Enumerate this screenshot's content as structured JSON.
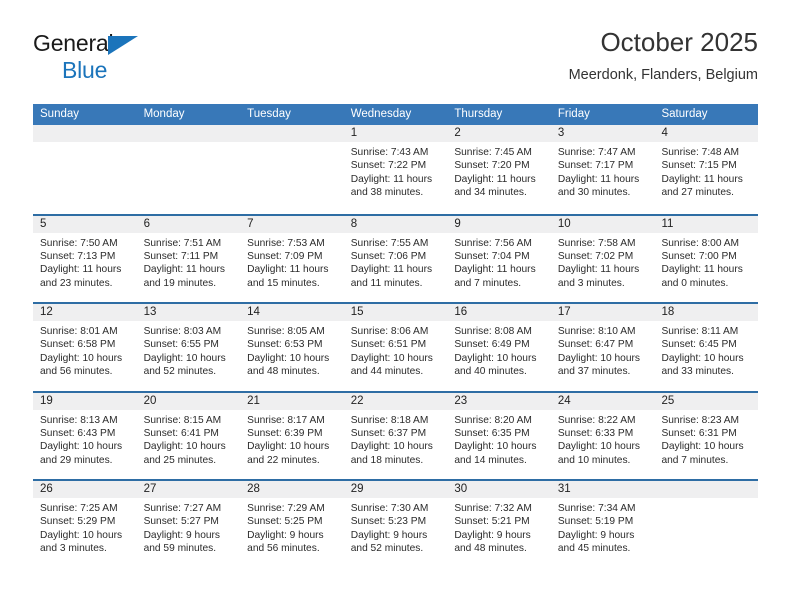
{
  "brand": {
    "line1": "General",
    "line2": "Blue",
    "accent_color": "#1b74bb",
    "text_color": "#1a1a1a"
  },
  "header": {
    "title": "October 2025",
    "subtitle": "Meerdonk, Flanders, Belgium"
  },
  "theme": {
    "header_bar_color": "#3878b8",
    "row_divider_color": "#2e6da4",
    "day_band_color": "#efeff0"
  },
  "weekdays": [
    "Sunday",
    "Monday",
    "Tuesday",
    "Wednesday",
    "Thursday",
    "Friday",
    "Saturday"
  ],
  "weeks": [
    [
      {
        "day": "",
        "sunrise": "",
        "sunset": "",
        "daylight_1": "",
        "daylight_2": ""
      },
      {
        "day": "",
        "sunrise": "",
        "sunset": "",
        "daylight_1": "",
        "daylight_2": ""
      },
      {
        "day": "",
        "sunrise": "",
        "sunset": "",
        "daylight_1": "",
        "daylight_2": ""
      },
      {
        "day": "1",
        "sunrise": "Sunrise: 7:43 AM",
        "sunset": "Sunset: 7:22 PM",
        "daylight_1": "Daylight: 11 hours",
        "daylight_2": "and 38 minutes."
      },
      {
        "day": "2",
        "sunrise": "Sunrise: 7:45 AM",
        "sunset": "Sunset: 7:20 PM",
        "daylight_1": "Daylight: 11 hours",
        "daylight_2": "and 34 minutes."
      },
      {
        "day": "3",
        "sunrise": "Sunrise: 7:47 AM",
        "sunset": "Sunset: 7:17 PM",
        "daylight_1": "Daylight: 11 hours",
        "daylight_2": "and 30 minutes."
      },
      {
        "day": "4",
        "sunrise": "Sunrise: 7:48 AM",
        "sunset": "Sunset: 7:15 PM",
        "daylight_1": "Daylight: 11 hours",
        "daylight_2": "and 27 minutes."
      }
    ],
    [
      {
        "day": "5",
        "sunrise": "Sunrise: 7:50 AM",
        "sunset": "Sunset: 7:13 PM",
        "daylight_1": "Daylight: 11 hours",
        "daylight_2": "and 23 minutes."
      },
      {
        "day": "6",
        "sunrise": "Sunrise: 7:51 AM",
        "sunset": "Sunset: 7:11 PM",
        "daylight_1": "Daylight: 11 hours",
        "daylight_2": "and 19 minutes."
      },
      {
        "day": "7",
        "sunrise": "Sunrise: 7:53 AM",
        "sunset": "Sunset: 7:09 PM",
        "daylight_1": "Daylight: 11 hours",
        "daylight_2": "and 15 minutes."
      },
      {
        "day": "8",
        "sunrise": "Sunrise: 7:55 AM",
        "sunset": "Sunset: 7:06 PM",
        "daylight_1": "Daylight: 11 hours",
        "daylight_2": "and 11 minutes."
      },
      {
        "day": "9",
        "sunrise": "Sunrise: 7:56 AM",
        "sunset": "Sunset: 7:04 PM",
        "daylight_1": "Daylight: 11 hours",
        "daylight_2": "and 7 minutes."
      },
      {
        "day": "10",
        "sunrise": "Sunrise: 7:58 AM",
        "sunset": "Sunset: 7:02 PM",
        "daylight_1": "Daylight: 11 hours",
        "daylight_2": "and 3 minutes."
      },
      {
        "day": "11",
        "sunrise": "Sunrise: 8:00 AM",
        "sunset": "Sunset: 7:00 PM",
        "daylight_1": "Daylight: 11 hours",
        "daylight_2": "and 0 minutes."
      }
    ],
    [
      {
        "day": "12",
        "sunrise": "Sunrise: 8:01 AM",
        "sunset": "Sunset: 6:58 PM",
        "daylight_1": "Daylight: 10 hours",
        "daylight_2": "and 56 minutes."
      },
      {
        "day": "13",
        "sunrise": "Sunrise: 8:03 AM",
        "sunset": "Sunset: 6:55 PM",
        "daylight_1": "Daylight: 10 hours",
        "daylight_2": "and 52 minutes."
      },
      {
        "day": "14",
        "sunrise": "Sunrise: 8:05 AM",
        "sunset": "Sunset: 6:53 PM",
        "daylight_1": "Daylight: 10 hours",
        "daylight_2": "and 48 minutes."
      },
      {
        "day": "15",
        "sunrise": "Sunrise: 8:06 AM",
        "sunset": "Sunset: 6:51 PM",
        "daylight_1": "Daylight: 10 hours",
        "daylight_2": "and 44 minutes."
      },
      {
        "day": "16",
        "sunrise": "Sunrise: 8:08 AM",
        "sunset": "Sunset: 6:49 PM",
        "daylight_1": "Daylight: 10 hours",
        "daylight_2": "and 40 minutes."
      },
      {
        "day": "17",
        "sunrise": "Sunrise: 8:10 AM",
        "sunset": "Sunset: 6:47 PM",
        "daylight_1": "Daylight: 10 hours",
        "daylight_2": "and 37 minutes."
      },
      {
        "day": "18",
        "sunrise": "Sunrise: 8:11 AM",
        "sunset": "Sunset: 6:45 PM",
        "daylight_1": "Daylight: 10 hours",
        "daylight_2": "and 33 minutes."
      }
    ],
    [
      {
        "day": "19",
        "sunrise": "Sunrise: 8:13 AM",
        "sunset": "Sunset: 6:43 PM",
        "daylight_1": "Daylight: 10 hours",
        "daylight_2": "and 29 minutes."
      },
      {
        "day": "20",
        "sunrise": "Sunrise: 8:15 AM",
        "sunset": "Sunset: 6:41 PM",
        "daylight_1": "Daylight: 10 hours",
        "daylight_2": "and 25 minutes."
      },
      {
        "day": "21",
        "sunrise": "Sunrise: 8:17 AM",
        "sunset": "Sunset: 6:39 PM",
        "daylight_1": "Daylight: 10 hours",
        "daylight_2": "and 22 minutes."
      },
      {
        "day": "22",
        "sunrise": "Sunrise: 8:18 AM",
        "sunset": "Sunset: 6:37 PM",
        "daylight_1": "Daylight: 10 hours",
        "daylight_2": "and 18 minutes."
      },
      {
        "day": "23",
        "sunrise": "Sunrise: 8:20 AM",
        "sunset": "Sunset: 6:35 PM",
        "daylight_1": "Daylight: 10 hours",
        "daylight_2": "and 14 minutes."
      },
      {
        "day": "24",
        "sunrise": "Sunrise: 8:22 AM",
        "sunset": "Sunset: 6:33 PM",
        "daylight_1": "Daylight: 10 hours",
        "daylight_2": "and 10 minutes."
      },
      {
        "day": "25",
        "sunrise": "Sunrise: 8:23 AM",
        "sunset": "Sunset: 6:31 PM",
        "daylight_1": "Daylight: 10 hours",
        "daylight_2": "and 7 minutes."
      }
    ],
    [
      {
        "day": "26",
        "sunrise": "Sunrise: 7:25 AM",
        "sunset": "Sunset: 5:29 PM",
        "daylight_1": "Daylight: 10 hours",
        "daylight_2": "and 3 minutes."
      },
      {
        "day": "27",
        "sunrise": "Sunrise: 7:27 AM",
        "sunset": "Sunset: 5:27 PM",
        "daylight_1": "Daylight: 9 hours",
        "daylight_2": "and 59 minutes."
      },
      {
        "day": "28",
        "sunrise": "Sunrise: 7:29 AM",
        "sunset": "Sunset: 5:25 PM",
        "daylight_1": "Daylight: 9 hours",
        "daylight_2": "and 56 minutes."
      },
      {
        "day": "29",
        "sunrise": "Sunrise: 7:30 AM",
        "sunset": "Sunset: 5:23 PM",
        "daylight_1": "Daylight: 9 hours",
        "daylight_2": "and 52 minutes."
      },
      {
        "day": "30",
        "sunrise": "Sunrise: 7:32 AM",
        "sunset": "Sunset: 5:21 PM",
        "daylight_1": "Daylight: 9 hours",
        "daylight_2": "and 48 minutes."
      },
      {
        "day": "31",
        "sunrise": "Sunrise: 7:34 AM",
        "sunset": "Sunset: 5:19 PM",
        "daylight_1": "Daylight: 9 hours",
        "daylight_2": "and 45 minutes."
      },
      {
        "day": "",
        "sunrise": "",
        "sunset": "",
        "daylight_1": "",
        "daylight_2": ""
      }
    ]
  ]
}
